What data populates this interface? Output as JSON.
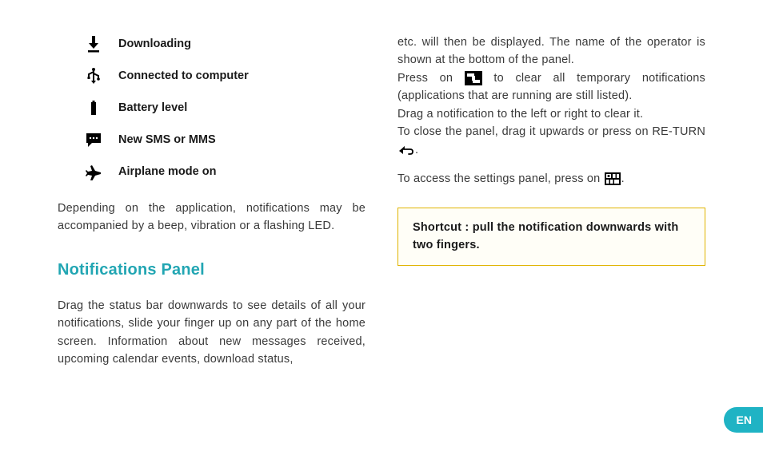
{
  "iconList": [
    {
      "icon": "download-icon",
      "label": "Downloading"
    },
    {
      "icon": "usb-icon",
      "label": "Connected to computer"
    },
    {
      "icon": "battery-icon",
      "label": "Battery level"
    },
    {
      "icon": "sms-icon",
      "label": "New SMS or MMS"
    },
    {
      "icon": "airplane-icon",
      "label": "Airplane mode on"
    }
  ],
  "leftPara1": "Depending on the application, notifications may be accompanied by a beep, vibration or a flashing LED.",
  "heading": "Notifications Panel",
  "leftPara2": "Drag the status bar downwards to see details of all your notifications, slide your finger up on any part of the home screen. Information about new messages received, upcoming calendar events, download status,",
  "rightPara1a": "etc. will then be displayed. The name of the operator is shown at the bottom of the panel.",
  "rightPara1b_pre": "Press on ",
  "rightPara1b_post": " to clear all temporary notifications (applications that are running are still listed).",
  "rightPara1c": "Drag a notification to the left or right to clear it.",
  "rightPara1d_pre": "To close the panel, drag it upwards or press on RE-TURN ",
  "rightPara1d_post": ".",
  "rightPara2_pre": "To access the settings panel, press on ",
  "rightPara2_post": ".",
  "tip": "Shortcut : pull the notification downwards with two fingers.",
  "langBadge": "EN"
}
